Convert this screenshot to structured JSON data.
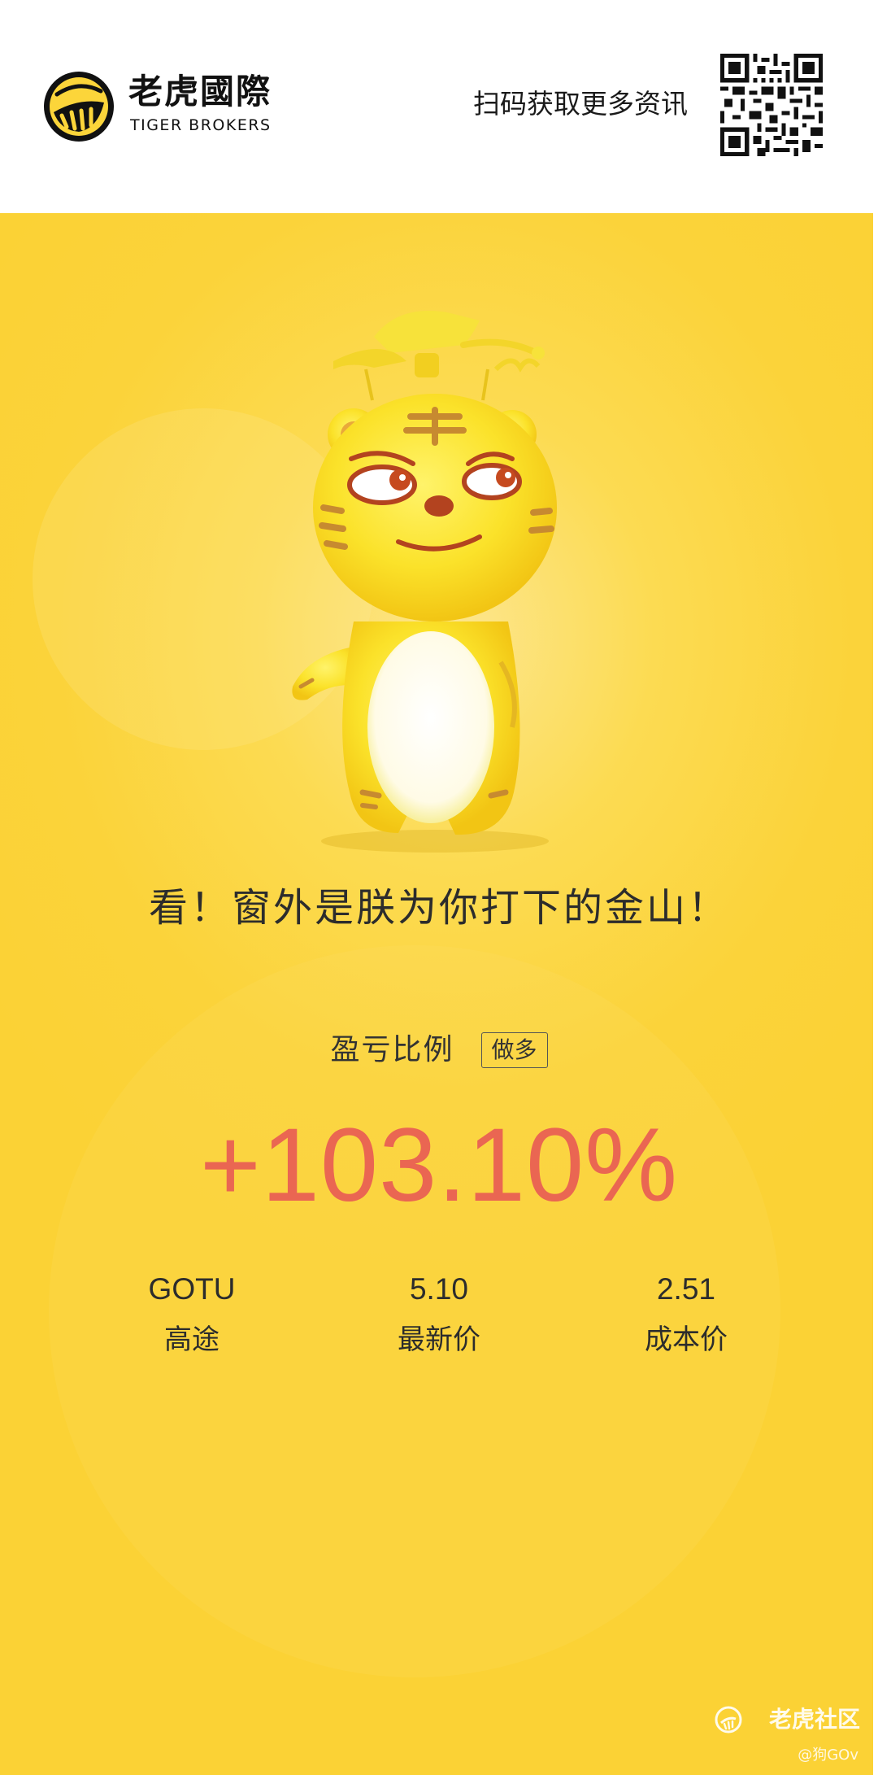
{
  "header": {
    "brand_cn": "老虎國際",
    "brand_en": "TIGER BROKERS",
    "scan_text": "扫码获取更多资讯",
    "logo_icon": "tiger-stripe-logo-icon",
    "qr_icon": "qr-code-icon"
  },
  "poster": {
    "slogan": "看！窗外是朕为你打下的金山！",
    "ratio_label": "盈亏比例",
    "direction": "做多",
    "pl_ratio": "+103.10%",
    "mascot_icon": "tiger-mascot-illustration",
    "stats": [
      {
        "value": "GOTU",
        "label": "高途"
      },
      {
        "value": "5.10",
        "label": "最新价"
      },
      {
        "value": "2.51",
        "label": "成本价"
      }
    ]
  },
  "watermark": {
    "brand": "老虎社区",
    "user": "@狗GOv"
  },
  "colors": {
    "background": "#fbd33a",
    "profit": "#ea6652",
    "text": "#2c2c2c"
  }
}
